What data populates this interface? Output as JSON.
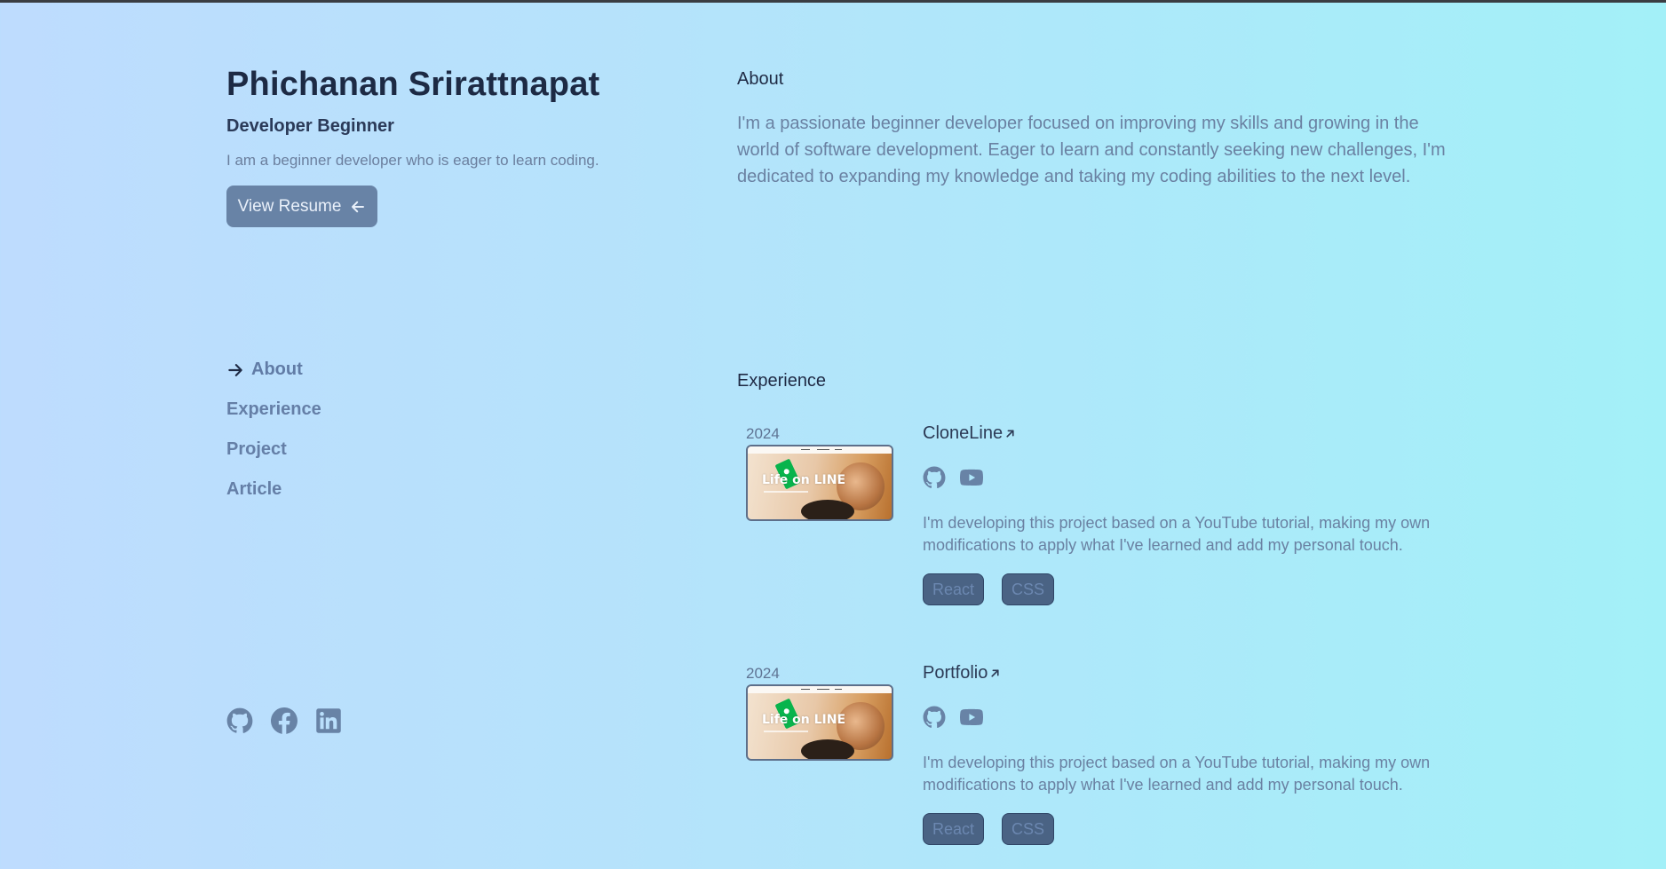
{
  "profile": {
    "name": "Phichanan Srirattnapat",
    "role": "Developer Beginner",
    "tagline": "I am a beginner developer who is eager to learn coding.",
    "resume_label": "View Resume"
  },
  "nav": {
    "items": [
      {
        "label": "About",
        "active": true
      },
      {
        "label": "Experience",
        "active": false
      },
      {
        "label": "Project",
        "active": false
      },
      {
        "label": "Article",
        "active": false
      }
    ]
  },
  "social": [
    "github-icon",
    "facebook-icon",
    "linkedin-icon"
  ],
  "about": {
    "heading": "About",
    "text": "I'm a passionate beginner developer focused on improving my skills and growing in the world of software development. Eager to learn and constantly seeking new challenges, I'm dedicated to expanding my knowledge and taking my coding abilities to the next level."
  },
  "experience": {
    "heading": "Experience",
    "items": [
      {
        "year": "2024",
        "title": "CloneLine",
        "thumb_text": "Life on LINE",
        "description": "I'm developing this project based on a YouTube tutorial, making my own modifications to apply what I've learned and add my personal touch.",
        "tags": [
          "React",
          "CSS"
        ]
      },
      {
        "year": "2024",
        "title": "Portfolio",
        "thumb_text": "Life on LINE",
        "description": "I'm developing this project based on a YouTube tutorial, making my own modifications to apply what I've learned and add my personal touch.",
        "tags": [
          "React",
          "CSS"
        ]
      }
    ]
  },
  "colors": {
    "accent": "#6883a6",
    "heading": "#1d2a44",
    "muted_text": "#6a81a2",
    "tag_bg": "#4a6384"
  }
}
